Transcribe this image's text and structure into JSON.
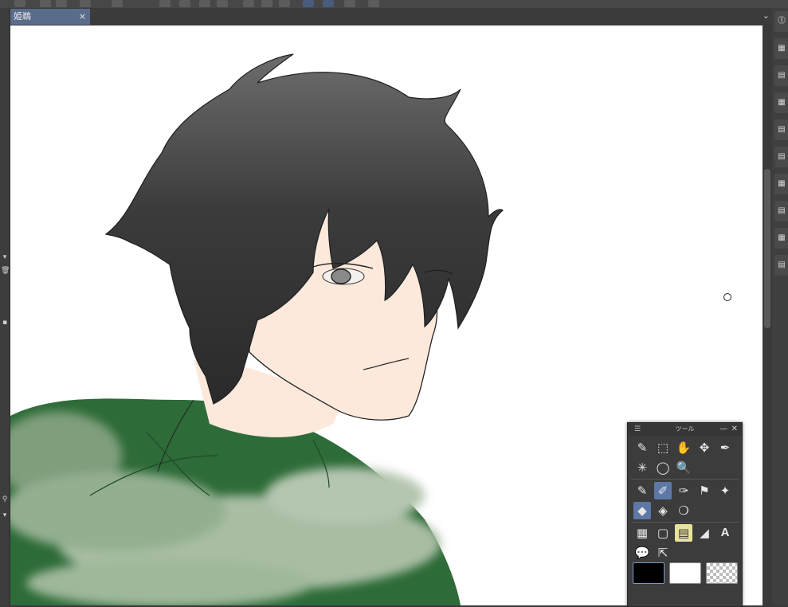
{
  "tab": {
    "title": "姫鵜",
    "close": "×",
    "menu": "⌄"
  },
  "tool_panel": {
    "title": "ツール",
    "grip": "☰",
    "minimize": "—",
    "close": "✕",
    "row1": [
      "✎",
      "⬚",
      "✋",
      "✥",
      "✒"
    ],
    "row2": [
      "✳",
      "◯",
      "🔍"
    ],
    "row3": [
      "✎",
      "✐",
      "✑",
      "⚑",
      "✦"
    ],
    "row4": [
      "◆",
      "◈",
      "❍"
    ],
    "row5": [
      "▦",
      "▢",
      "▤",
      "◢",
      "A"
    ],
    "row6": [
      "💬",
      "⇱"
    ]
  },
  "swatches": {
    "main_color": "#000000",
    "sub_color": "#ffffff",
    "transparent": "checker"
  },
  "colors": {
    "hair": "#3a3a3a",
    "skin": "#fde9dc",
    "jacket_dark": "#2d6b38",
    "jacket_light": "#8fae8a",
    "accent": "#5d77a6"
  },
  "right_dock": {
    "buttons": [
      "⓵",
      "▦",
      "▤",
      "▦",
      "▤",
      "▤",
      "▦",
      "▤",
      "▦",
      "▤"
    ]
  },
  "left_panel": {
    "icons": [
      "▾",
      "🗑",
      "▪",
      "⚲",
      "▾"
    ]
  }
}
